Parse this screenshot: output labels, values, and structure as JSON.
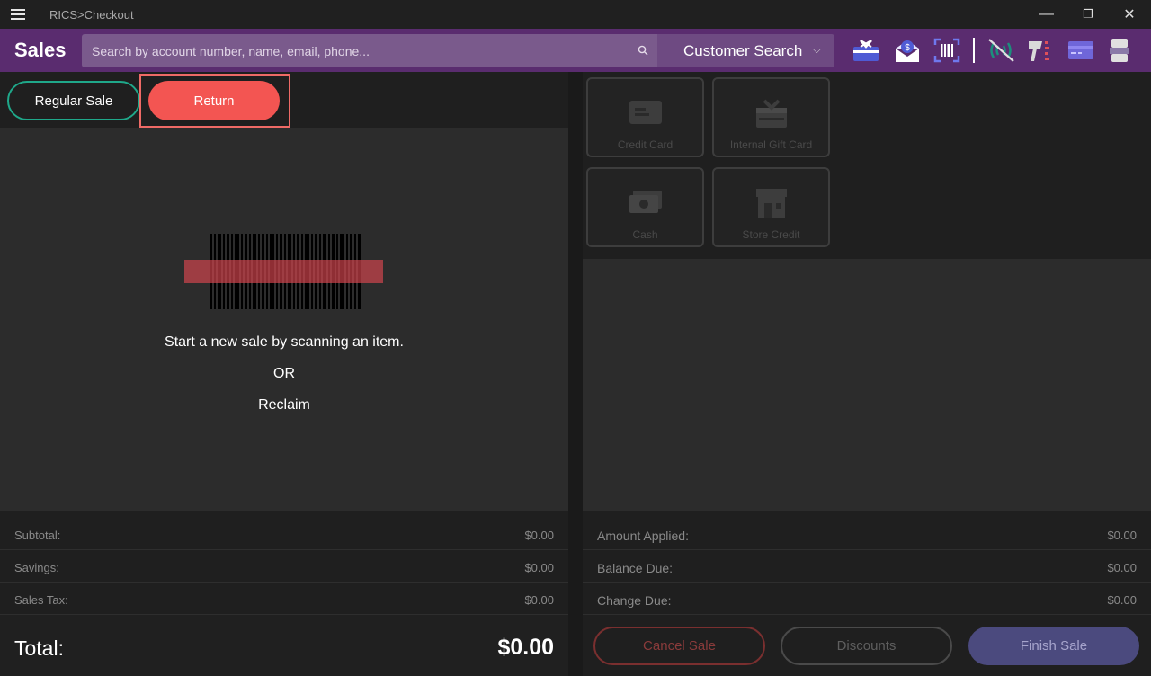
{
  "window": {
    "title": "RICS>Checkout",
    "minimize": "—",
    "restore": "❐",
    "close": "✕"
  },
  "appbar": {
    "brand": "Sales",
    "search_placeholder": "Search by account number, name, email, phone...",
    "customer_search_label": "Customer Search",
    "toolbar_icons": [
      "gift-card-icon",
      "mail-dollar-icon",
      "barcode-scan-icon",
      "wireless-off-icon",
      "scanner-gun-icon",
      "credit-card-icon",
      "receipt-printer-icon"
    ],
    "colors": {
      "bar": "#5a2c6f",
      "gift": "#4f5bd5",
      "accent_red": "#f35552",
      "accent_teal": "#1fa88a"
    }
  },
  "mode": {
    "regular_label": "Regular Sale",
    "return_label": "Return",
    "selected": "Return"
  },
  "cart": {
    "message_line1": "Start a new sale by scanning an item.",
    "message_or": "OR",
    "message_reclaim": "Reclaim"
  },
  "totals": {
    "rows": [
      {
        "label": "Subtotal:",
        "value": "$0.00"
      },
      {
        "label": "Savings:",
        "value": "$0.00"
      },
      {
        "label": "Sales Tax:",
        "value": "$0.00"
      }
    ],
    "total_label": "Total:",
    "total_value": "$0.00"
  },
  "tenders": [
    {
      "label": "Credit Card",
      "icon": "credit-card-icon"
    },
    {
      "label": "Internal Gift Card",
      "icon": "gift-icon"
    },
    {
      "label": "Cash",
      "icon": "cash-icon"
    },
    {
      "label": "Store Credit",
      "icon": "store-icon"
    }
  ],
  "payment": {
    "rows": [
      {
        "label": "Amount Applied:",
        "value": "$0.00"
      },
      {
        "label": "Balance Due:",
        "value": "$0.00"
      },
      {
        "label": "Change Due:",
        "value": "$0.00"
      }
    ],
    "cancel_label": "Cancel Sale",
    "discounts_label": "Discounts",
    "finish_label": "Finish Sale"
  }
}
